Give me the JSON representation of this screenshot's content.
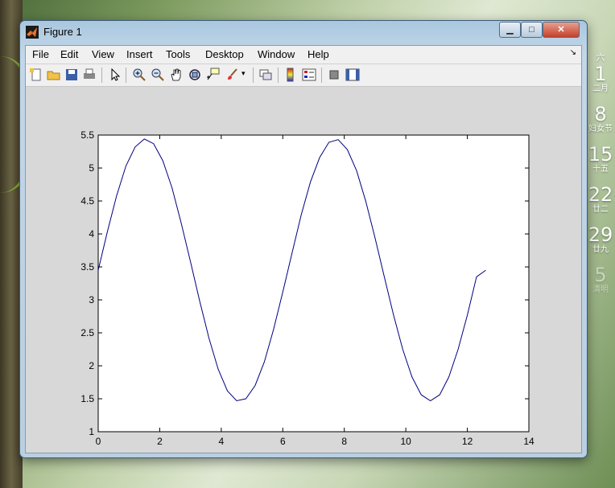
{
  "window": {
    "title": "Figure 1",
    "minimize_icon": "minimize-icon",
    "maximize_icon": "maximize-icon",
    "close_icon": "close-icon"
  },
  "menu": [
    "File",
    "Edit",
    "View",
    "Insert",
    "Tools",
    "Desktop",
    "Window",
    "Help"
  ],
  "toolbar_icons": [
    "new-figure-icon",
    "open-file-icon",
    "save-icon",
    "print-icon",
    "select-arrow-icon",
    "zoom-in-icon",
    "zoom-out-icon",
    "pan-icon",
    "rotate-3d-icon",
    "data-cursor-icon",
    "brush-icon",
    "link-plot-icon",
    "colorbar-icon",
    "legend-icon",
    "hide-plot-tools-icon",
    "show-plot-tools-icon"
  ],
  "calendar": {
    "top": "六",
    "items": [
      {
        "num": "1",
        "sub": "二月"
      },
      {
        "num": "8",
        "sub": "妇女节"
      },
      {
        "num": "15",
        "sub": "十五"
      },
      {
        "num": "22",
        "sub": "廿二"
      },
      {
        "num": "29",
        "sub": "廿九"
      },
      {
        "num": "5",
        "sub": "清明"
      }
    ]
  },
  "chart_data": {
    "type": "line",
    "title": "",
    "xlabel": "",
    "ylabel": "",
    "xlim": [
      0,
      14
    ],
    "ylim": [
      1,
      5.5
    ],
    "xticks": [
      "0",
      "2",
      "4",
      "6",
      "8",
      "10",
      "12",
      "14"
    ],
    "yticks": [
      "1",
      "1.5",
      "2",
      "2.5",
      "3",
      "3.5",
      "4",
      "4.5",
      "5",
      "5.5"
    ],
    "grid": false,
    "series": [
      {
        "color": "#000080",
        "x": [
          0,
          0.3,
          0.6,
          0.9,
          1.2,
          1.5,
          1.8,
          2.1,
          2.4,
          2.7,
          3.0,
          3.3,
          3.6,
          3.9,
          4.2,
          4.5,
          4.8,
          5.1,
          5.4,
          5.7,
          6.0,
          6.3,
          6.6,
          6.9,
          7.2,
          7.5,
          7.8,
          8.1,
          8.4,
          8.7,
          9.0,
          9.3,
          9.6,
          9.9,
          10.2,
          10.5,
          10.8,
          11.1,
          11.4,
          11.7,
          12.0,
          12.3,
          12.6
        ],
        "y": [
          3.45,
          4.04,
          4.58,
          5.03,
          5.32,
          5.44,
          5.37,
          5.11,
          4.7,
          4.16,
          3.58,
          2.98,
          2.42,
          1.95,
          1.62,
          1.47,
          1.5,
          1.7,
          2.06,
          2.55,
          3.12,
          3.71,
          4.29,
          4.79,
          5.16,
          5.39,
          5.43,
          5.28,
          4.96,
          4.49,
          3.94,
          3.35,
          2.77,
          2.25,
          1.83,
          1.56,
          1.47,
          1.56,
          1.83,
          2.25,
          2.77,
          3.35,
          3.45
        ]
      }
    ]
  }
}
